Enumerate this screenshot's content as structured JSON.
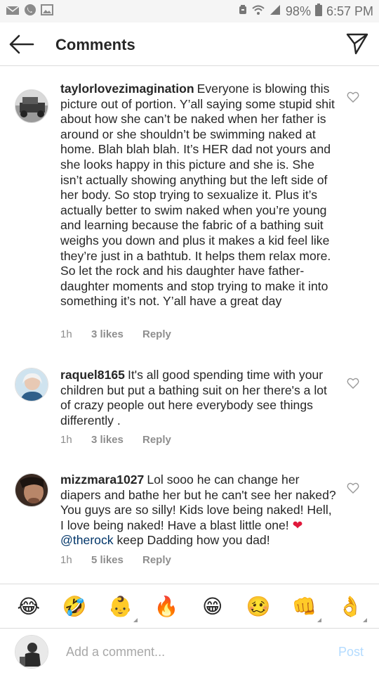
{
  "status_bar": {
    "battery": "98%",
    "time": "6:57 PM",
    "icons": [
      "mail-icon",
      "whatsapp-icon",
      "image-icon",
      "alarm-icon",
      "wifi-icon",
      "signal-icon",
      "battery-icon"
    ]
  },
  "header": {
    "title": "Comments",
    "back_icon": "arrow-left-icon",
    "share_icon": "direct-send-icon"
  },
  "comments": [
    {
      "username": "taylorlovezimagination",
      "text": "Everyone is blowing this picture out of portion. Y’all saying some stupid shit about how she can’t be naked when her father is around or she shouldn’t be swimming naked at home. Blah blah blah. It’s HER dad not yours and she looks happy in this picture and she is. She isn’t actually showing anything but the left side of her body. So stop trying to sexualize it. Plus it’s actually better to swim naked when you’re young and learning because the fabric of a bathing suit weighs you down and plus it makes a kid feel like they’re just in a bathtub. It helps them relax more. So let the rock and his daughter have father-daughter moments and stop trying to make it into something it’s not. Y’all have a great day",
      "time": "1h",
      "likes": "3 likes",
      "reply": "Reply"
    },
    {
      "username": "raquel8165",
      "text": "It's all good spending time with your children but put a bathing suit on her there's a lot of crazy people out here everybody see things differently .",
      "time": "1h",
      "likes": "3 likes",
      "reply": "Reply"
    },
    {
      "username": "mizzmara1027",
      "text": "Lol sooo he can change her diapers and bathe her but he can't see her naked? You guys are so silly! Kids love being naked! Hell, I love being naked! Have a blast little one!",
      "heart": "❤",
      "mention": "@therock",
      "text_after": "keep Dadding how you dad!",
      "time": "1h",
      "likes": "5 likes",
      "reply": "Reply"
    }
  ],
  "emoji_bar": [
    "😂",
    "🤣",
    "👶",
    "🔥",
    "😁",
    "🥴",
    "👊",
    "👌"
  ],
  "add_comment": {
    "placeholder": "Add a comment...",
    "post_label": "Post"
  },
  "colors": {
    "heart_red": "#e0183b",
    "mention_blue": "#003569",
    "post_disabled": "#b3dbff",
    "meta_gray": "#8e8e8e"
  }
}
